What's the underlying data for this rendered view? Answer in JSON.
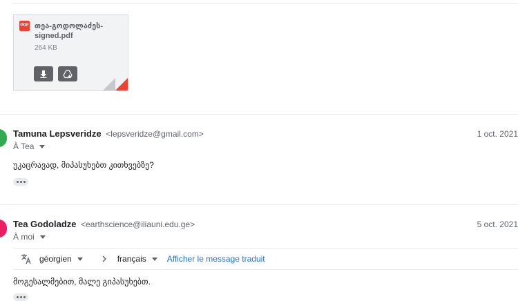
{
  "attachment": {
    "type_badge": "PDF",
    "filename": "თეა-გოდოლაძეს-signed.pdf",
    "size": "264 KB",
    "download_icon": "download-icon",
    "drive_icon": "add-to-drive-icon",
    "badge_color": "#ea4335"
  },
  "messages": [
    {
      "sender_name": "Tamuna Lepsveridze",
      "sender_email": "<lepsveridze@gmail.com>",
      "date": "1 oct. 2021",
      "recipient": "À Tea",
      "body": "უკაცრავად, მიპასუხებთ კითხვებზე?",
      "avatar_color": "#34a853"
    },
    {
      "sender_name": "Tea Godoladze",
      "sender_email": "<earthscience@iliauni.edu.ge>",
      "date": "5 oct. 2021",
      "recipient": "À moi",
      "body": "მოგესალმებით, მალე გიპასუხებთ.",
      "avatar_color": "#e91e63"
    }
  ],
  "translate": {
    "icon": "translate-icon",
    "source_language": "géorgien",
    "target_language": "français",
    "action": "Afficher le message traduit",
    "link_color": "#1a73e8"
  }
}
